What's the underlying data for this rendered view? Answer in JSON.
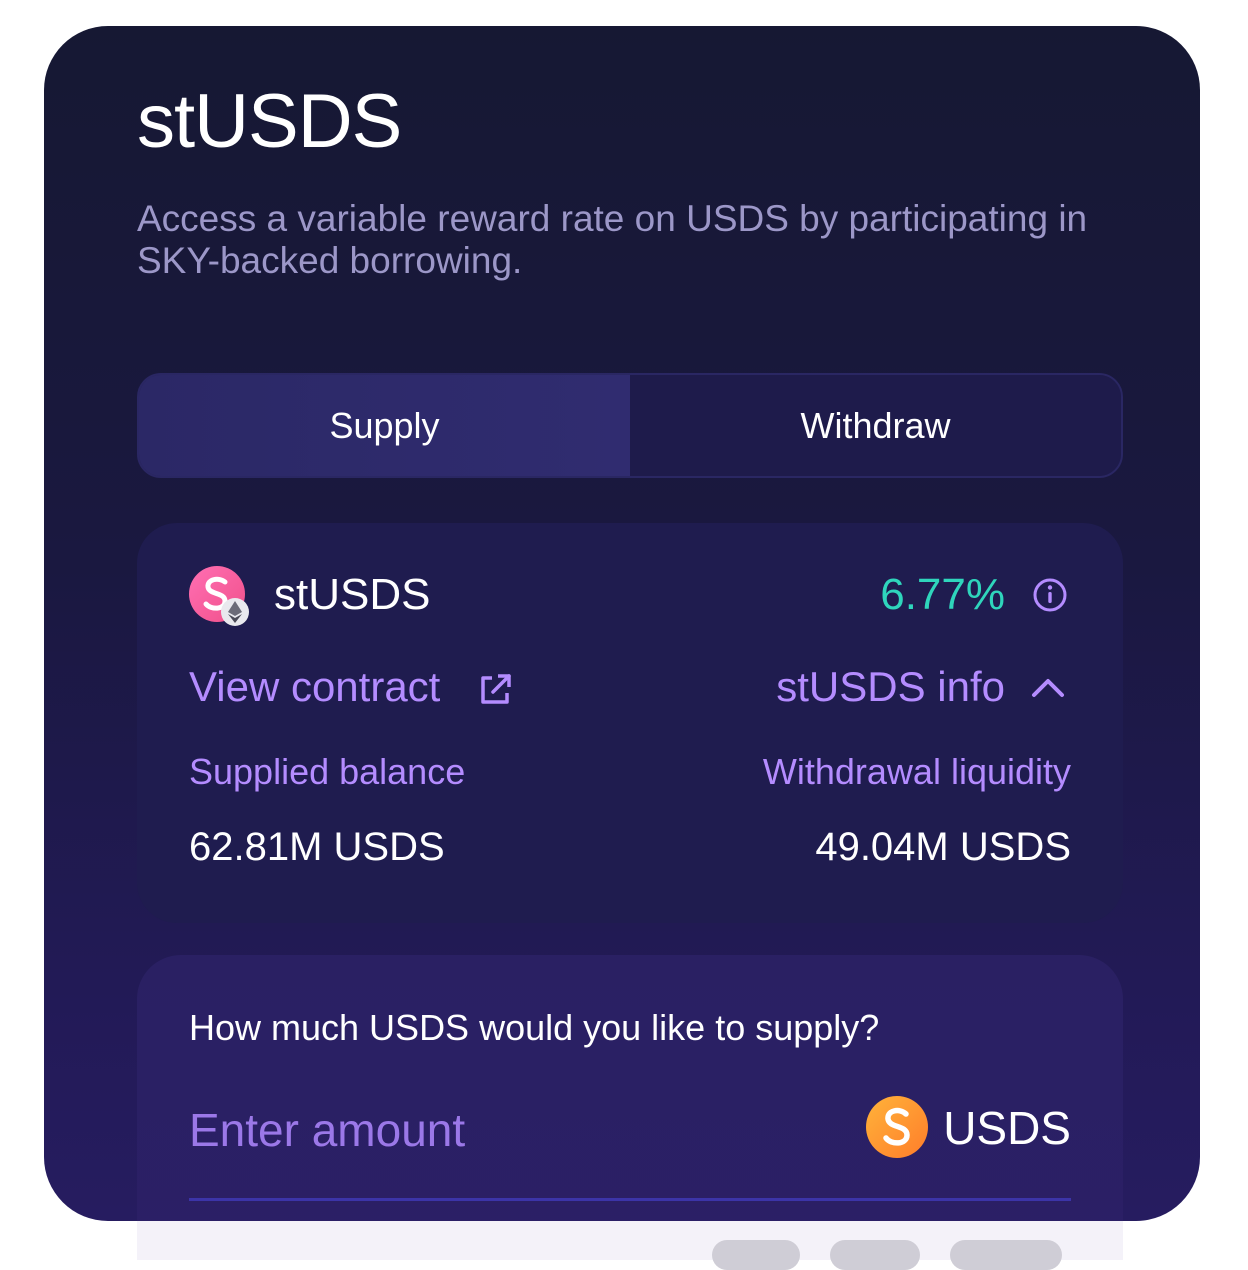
{
  "header": {
    "title": "stUSDS",
    "subtitle": "Access a variable reward rate on USDS by participating in SKY-backed borrowing."
  },
  "tabs": [
    {
      "label": "Supply",
      "active": true
    },
    {
      "label": "Withdraw",
      "active": false
    }
  ],
  "info": {
    "token_name": "stUSDS",
    "rate": "6.77%",
    "view_contract": "View contract",
    "token_info": "stUSDS info",
    "supplied_balance_label": "Supplied balance",
    "supplied_balance_value": "62.81M USDS",
    "withdrawal_liquidity_label": "Withdrawal liquidity",
    "withdrawal_liquidity_value": "49.04M USDS"
  },
  "supply": {
    "question": "How much USDS would you like to supply?",
    "placeholder": "Enter amount",
    "token": "USDS"
  },
  "colors": {
    "accent": "#b48cff",
    "rate": "#2fd5bc",
    "background": "#1a1840"
  }
}
